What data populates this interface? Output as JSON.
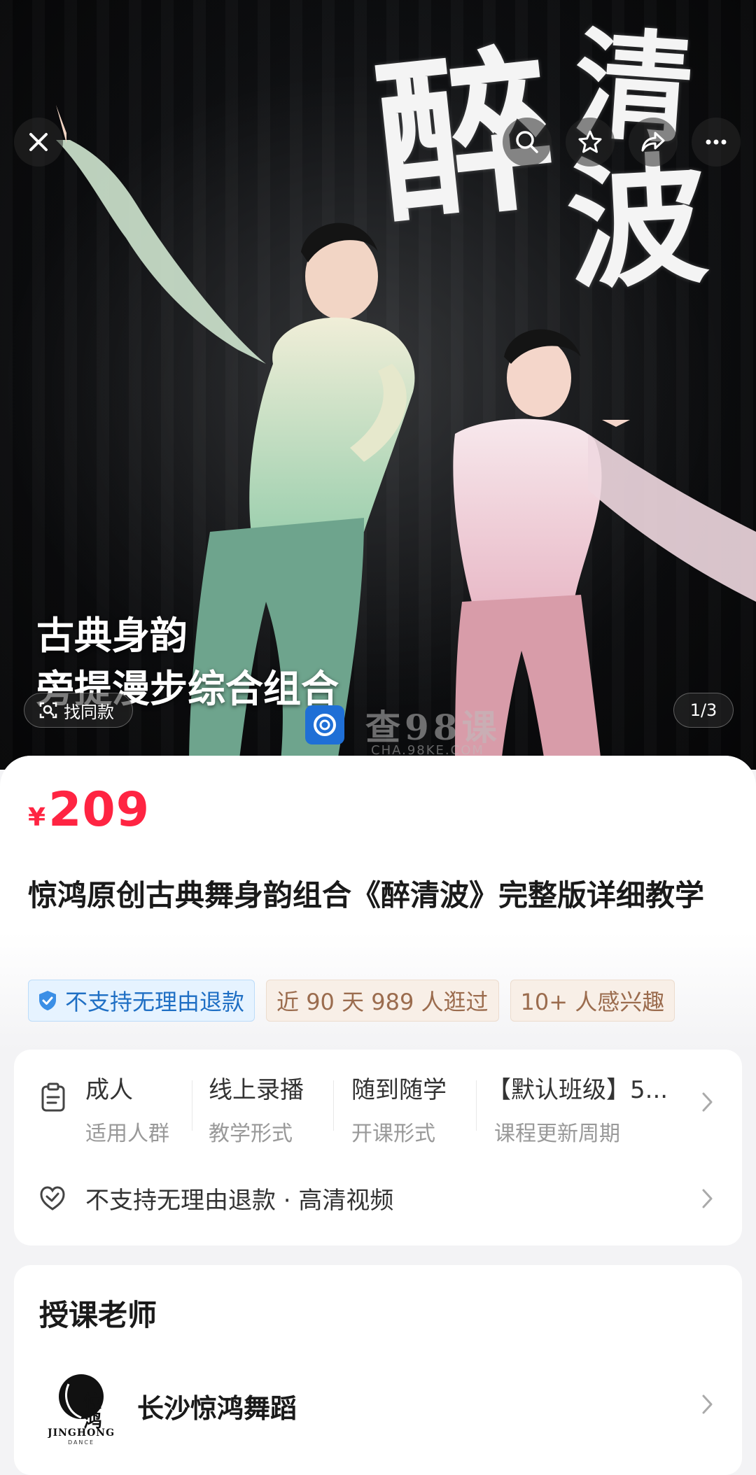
{
  "hero": {
    "calligraphy": [
      "醉",
      "清",
      "波"
    ],
    "subtitle_line1": "古典身韵",
    "subtitle_line2": "旁提漫步综合组合",
    "find_similar_label": "找同款",
    "page_indicator": "1/3",
    "watermark_text": "查98课",
    "watermark_url": "CHA.98KE.COM",
    "icons": [
      "close-icon",
      "search-icon",
      "star-icon",
      "share-icon",
      "more-icon"
    ]
  },
  "product": {
    "currency": "¥",
    "price": "209",
    "title": "惊鸿原创古典舞身韵组合《醉清波》完整版详细教学",
    "tags": [
      {
        "label": "不支持无理由退款",
        "style": "blue",
        "icon": "shield-check-icon"
      },
      {
        "label": "近 90 天 989 人逛过",
        "style": "beige"
      },
      {
        "label": "10+ 人感兴趣",
        "style": "beige"
      }
    ]
  },
  "course_info": {
    "attributes": [
      {
        "value": "成人",
        "label": "适用人群"
      },
      {
        "value": "线上录播",
        "label": "教学形式"
      },
      {
        "value": "随到随学",
        "label": "开课形式"
      },
      {
        "value": "【默认班级】5...",
        "label": "课程更新周期"
      }
    ],
    "service_text": "不支持无理由退款 · 高清视频"
  },
  "teacher": {
    "heading": "授课老师",
    "name": "长沙惊鸿舞蹈",
    "logo_text_cn": "惊鸿",
    "logo_text_en": "JINGHONG",
    "logo_text_sub": "DANCE"
  },
  "colors": {
    "price": "#ff2442",
    "tag_blue_bg": "#e6f3ff",
    "tag_blue_text": "#1f6fc4",
    "tag_beige_bg": "#f8efe7",
    "tag_beige_text": "#9b6c4e"
  }
}
